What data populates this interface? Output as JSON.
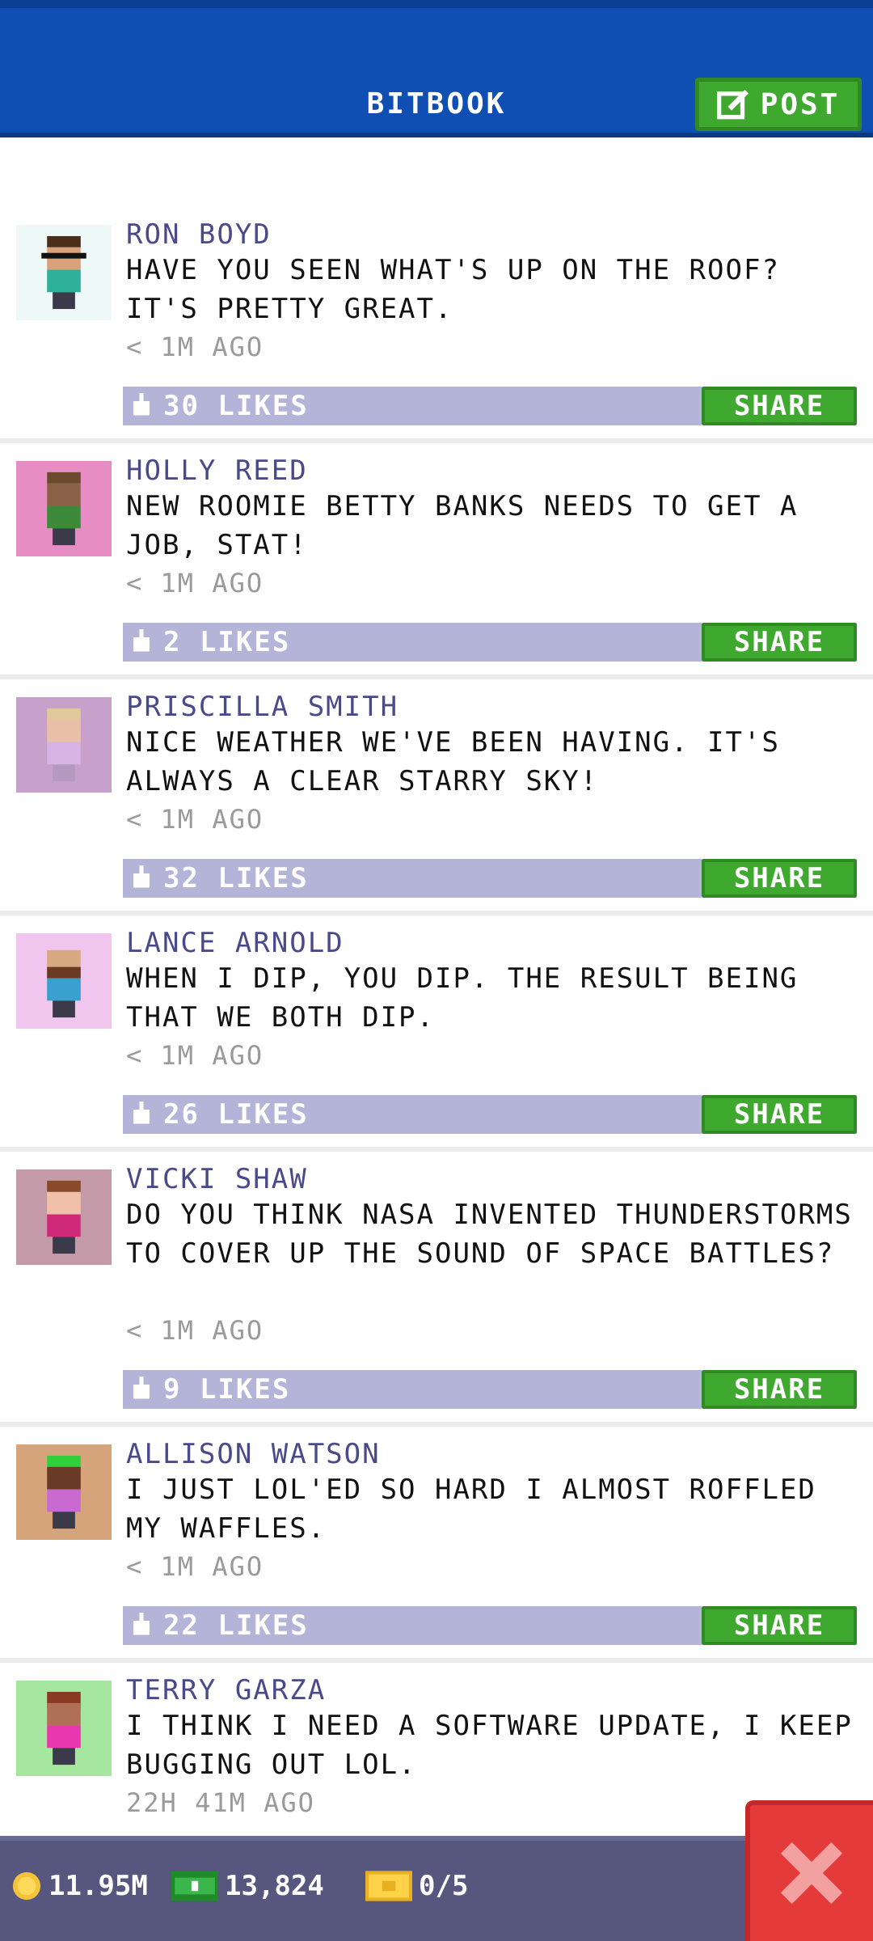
{
  "header": {
    "title": "BITBOOK",
    "post_label": "POST"
  },
  "posts": [
    {
      "name": "RON BOYD",
      "message": "HAVE YOU SEEN WHAT'S UP ON THE ROOF? IT'S PRETTY GREAT.",
      "time": "< 1M AGO",
      "likes": "30 LIKES",
      "share": "SHARE",
      "avatar_bg": "#eef8f6"
    },
    {
      "name": "HOLLY REED",
      "message": "NEW ROOMIE BETTY BANKS NEEDS TO GET A JOB, STAT!",
      "time": "< 1M AGO",
      "likes": "2 LIKES",
      "share": "SHARE",
      "avatar_bg": "#e88dc4"
    },
    {
      "name": "PRISCILLA SMITH",
      "message": "NICE WEATHER WE'VE BEEN HAVING. IT'S ALWAYS A CLEAR STARRY SKY!",
      "time": "< 1M AGO",
      "likes": "32 LIKES",
      "share": "SHARE",
      "avatar_bg": "#c8a0cc"
    },
    {
      "name": "LANCE ARNOLD",
      "message": "WHEN I DIP, YOU DIP. THE RESULT BEING THAT WE BOTH DIP.",
      "time": "< 1M AGO",
      "likes": "26 LIKES",
      "share": "SHARE",
      "avatar_bg": "#f0c6ee"
    },
    {
      "name": "VICKI SHAW",
      "message": "DO YOU THINK NASA INVENTED THUNDERSTORMS TO COVER UP THE SOUND OF SPACE BATTLES?",
      "time": "< 1M AGO",
      "likes": "9 LIKES",
      "share": "SHARE",
      "avatar_bg": "#c49aa8"
    },
    {
      "name": "ALLISON WATSON",
      "message": "I JUST LOL'ED SO HARD I ALMOST ROFFLED MY WAFFLES.",
      "time": "< 1M AGO",
      "likes": "22 LIKES",
      "share": "SHARE",
      "avatar_bg": "#d6a47a"
    },
    {
      "name": "TERRY GARZA",
      "message": "I THINK I NEED A SOFTWARE UPDATE, I KEEP BUGGING OUT LOL.",
      "time": "22H 41M AGO",
      "likes": "",
      "share": "",
      "avatar_bg": "#a6e7a0"
    }
  ],
  "bottom_bar": {
    "coins": "11.95M",
    "bux": "13,824",
    "tickets": "0/5"
  },
  "colors": {
    "header": "#0f4fb4",
    "share_green": "#3ea82f",
    "like_bar": "#b3b4d8",
    "close_red": "#e53a3a"
  },
  "icons": {
    "post": "edit-icon",
    "like": "thumbs-up-icon",
    "coin": "coin-icon",
    "bux": "bux-icon",
    "ticket": "ticket-icon",
    "close": "close-icon"
  }
}
